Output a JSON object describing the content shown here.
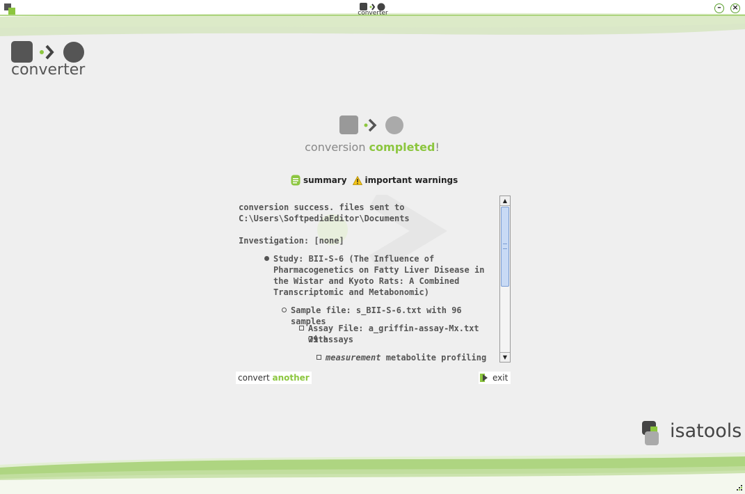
{
  "window": {
    "title_caption": "converter",
    "minimize_symbol": "–",
    "close_symbol": "×"
  },
  "brand": {
    "name": "converter"
  },
  "status": {
    "headline_prefix": "conversion ",
    "headline_accent": "completed",
    "headline_suffix": "!"
  },
  "tabs": [
    {
      "label": "summary",
      "icon": "document-icon"
    },
    {
      "label": "important warnings",
      "icon": "warning-icon"
    }
  ],
  "summary": {
    "message_line1": "conversion success. files sent to",
    "message_line2": "C:\\Users\\SoftpediaEditor\\Documents",
    "investigation": "Investigation: [none]",
    "study_lines": [
      "Study: BII-S-6 (The Influence of",
      "Pharmacogenetics on Fatty Liver Disease in",
      "the Wistar and Kyoto Rats: A Combined",
      "Transcriptomic and Metabonomic)"
    ],
    "sample_file": "Sample file: s_BII-S-6.txt with 96 samples",
    "assay_lines": [
      "Assay File: a_griffin-assay-Mx.txt with",
      "79 assays"
    ],
    "measurement_em": "measurement",
    "measurement_rest": " metabolite profiling"
  },
  "actions": {
    "convert_prefix": "convert ",
    "convert_accent": "another",
    "exit_label": "exit"
  },
  "footer": {
    "brand": "isatools"
  },
  "colors": {
    "accent_green": "#8cc63f",
    "dark_square": "#555555",
    "light_gray": "#aaaaaa"
  }
}
